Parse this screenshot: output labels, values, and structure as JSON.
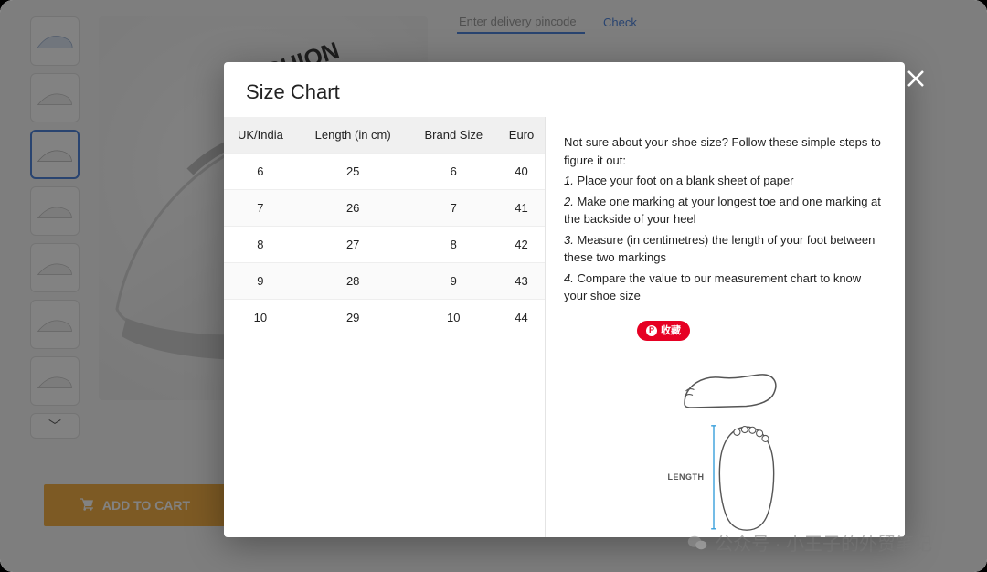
{
  "page": {
    "pincode_placeholder": "Enter delivery pincode",
    "check_label": "Check",
    "add_to_cart": "ADD TO CART",
    "thumb_down_glyph": "﹀"
  },
  "modal": {
    "title": "Size Chart",
    "headers": {
      "c0": "UK/India",
      "c1": "Length (in cm)",
      "c2": "Brand Size",
      "c3": "Euro"
    },
    "rows": [
      {
        "uk": "6",
        "len": "25",
        "brand": "6",
        "euro": "40"
      },
      {
        "uk": "7",
        "len": "26",
        "brand": "7",
        "euro": "41"
      },
      {
        "uk": "8",
        "len": "27",
        "brand": "8",
        "euro": "42"
      },
      {
        "uk": "9",
        "len": "28",
        "brand": "9",
        "euro": "43"
      },
      {
        "uk": "10",
        "len": "29",
        "brand": "10",
        "euro": "44"
      }
    ],
    "instructions": {
      "intro": "Not sure about your shoe size? Follow these simple steps to figure it out:",
      "s1_num": "1.",
      "s1": "Place your foot on a blank sheet of paper",
      "s2_num": "2.",
      "s2": "Make one marking at your longest toe and one marking at the backside of your heel",
      "s3_num": "3.",
      "s3": "Measure (in centimetres) the length of your foot between these two markings",
      "s4_num": "4.",
      "s4": "Compare the value to our measurement chart to know your shoe size",
      "length_label": "LENGTH"
    },
    "pin_badge": "收藏"
  },
  "watermark": "公众号 · 小王子的外贸笔记",
  "chart_data": {
    "type": "table",
    "title": "Size Chart",
    "columns": [
      "UK/India",
      "Length (in cm)",
      "Brand Size",
      "Euro"
    ],
    "rows": [
      [
        6,
        25,
        6,
        40
      ],
      [
        7,
        26,
        7,
        41
      ],
      [
        8,
        27,
        8,
        42
      ],
      [
        9,
        28,
        9,
        43
      ],
      [
        10,
        29,
        10,
        44
      ]
    ]
  }
}
